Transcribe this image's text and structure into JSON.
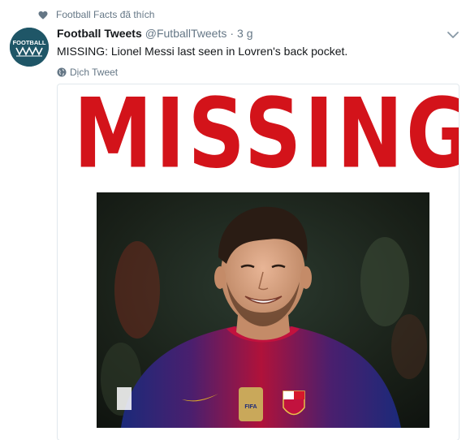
{
  "social_context": {
    "icon": "heart-icon",
    "text": "Football Facts đã thích"
  },
  "author": {
    "avatar_text": "FOOTBALL",
    "fullname": "Football Tweets",
    "username": "@FutballTweets",
    "separator": "·",
    "time": "3 g"
  },
  "tweet": {
    "text": "MISSING: Lionel Messi last seen in Lovren's back pocket.",
    "translate_label": "Dịch Tweet"
  },
  "media": {
    "headline": "MISSING",
    "headline_color": "#d3131a"
  },
  "colors": {
    "secondary_text": "#657786",
    "primary_text": "#14171a",
    "border": "#e1e8ed"
  }
}
